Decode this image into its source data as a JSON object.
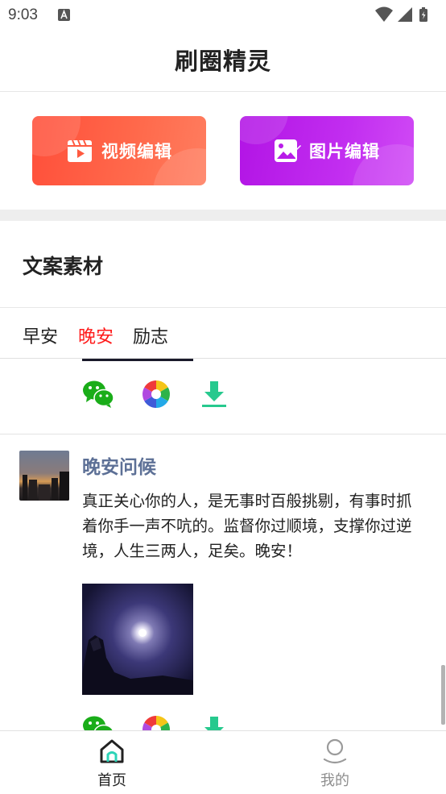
{
  "status_bar": {
    "time": "9:03",
    "left_icons": [
      "notification-a-icon"
    ],
    "right_icons": [
      "wifi-icon",
      "signal-icon",
      "battery-icon"
    ]
  },
  "header": {
    "title": "刷圈精灵"
  },
  "actions": {
    "video_edit_label": "视频编辑",
    "image_edit_label": "图片编辑",
    "video_color": "#ff5a40",
    "image_color": "#b81ce8"
  },
  "section": {
    "title": "文案素材"
  },
  "tabs": [
    {
      "label": "早安",
      "active": false
    },
    {
      "label": "晚安",
      "active": true
    },
    {
      "label": "励志",
      "active": false
    }
  ],
  "accent_colors": {
    "tab_active": "#ff1a1a",
    "post_title": "#5d7096",
    "wechat_green": "#1aad19",
    "download_green": "#27c98e"
  },
  "feed": {
    "post": {
      "title": "晚安问候",
      "text": "真正关心你的人，是无事时百般挑剔，有事时抓着你手一声不吭的。监督你过顺境，支撑你过逆境，人生三两人，足矣。晚安！",
      "action_icons": [
        "wechat-icon",
        "moments-shutter-icon",
        "download-icon"
      ]
    }
  },
  "bottom_nav": [
    {
      "label": "首页",
      "icon": "home-icon",
      "active": true
    },
    {
      "label": "我的",
      "icon": "profile-icon",
      "active": false
    }
  ]
}
